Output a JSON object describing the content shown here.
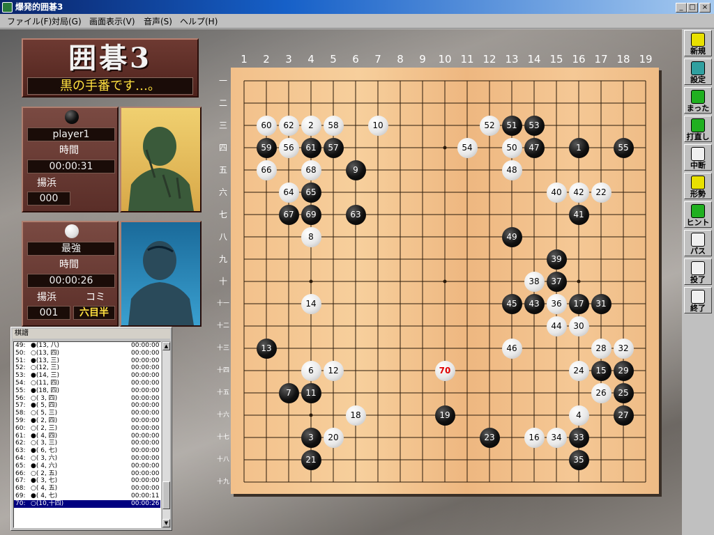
{
  "window": {
    "title": "爆発的囲碁3",
    "min": "_",
    "max": "□",
    "close": "×"
  },
  "menu": [
    "ファイル(F)",
    "対局(G)",
    "画面表示(V)",
    "音声(S)",
    "ヘルプ(H)"
  ],
  "logo": {
    "title": "囲碁3",
    "turn": "黒の手番です…。"
  },
  "player_black": {
    "name": "player1",
    "time_label": "時間",
    "time": "00:00:31",
    "captures_label": "揚浜",
    "captures": "000"
  },
  "player_white": {
    "name": "最強",
    "time_label": "時間",
    "time": "00:00:26",
    "captures_label": "揚浜",
    "komi_label": "コミ",
    "captures": "001",
    "komi": "六目半"
  },
  "kifu": {
    "title": "棋譜",
    "rows": [
      {
        "num": "49:",
        "move": "●(13, 八)",
        "time": "00:00:00"
      },
      {
        "num": "50:",
        "move": "○(13, 四)",
        "time": "00:00:00"
      },
      {
        "num": "51:",
        "move": "●(13, 三)",
        "time": "00:00:00"
      },
      {
        "num": "52:",
        "move": "○(12, 三)",
        "time": "00:00:00"
      },
      {
        "num": "53:",
        "move": "●(14, 三)",
        "time": "00:00:00"
      },
      {
        "num": "54:",
        "move": "○(11, 四)",
        "time": "00:00:00"
      },
      {
        "num": "55:",
        "move": "●(18, 四)",
        "time": "00:00:00"
      },
      {
        "num": "56:",
        "move": "○( 3, 四)",
        "time": "00:00:00"
      },
      {
        "num": "57:",
        "move": "●( 5, 四)",
        "time": "00:00:00"
      },
      {
        "num": "58:",
        "move": "○( 5, 三)",
        "time": "00:00:00"
      },
      {
        "num": "59:",
        "move": "●( 2, 四)",
        "time": "00:00:00"
      },
      {
        "num": "60:",
        "move": "○( 2, 三)",
        "time": "00:00:00"
      },
      {
        "num": "61:",
        "move": "●( 4, 四)",
        "time": "00:00:00"
      },
      {
        "num": "62:",
        "move": "○( 3, 三)",
        "time": "00:00:00"
      },
      {
        "num": "63:",
        "move": "●( 6, 七)",
        "time": "00:00:00"
      },
      {
        "num": "64:",
        "move": "○( 3, 六)",
        "time": "00:00:00"
      },
      {
        "num": "65:",
        "move": "●( 4, 六)",
        "time": "00:00:00"
      },
      {
        "num": "66:",
        "move": "○( 2, 五)",
        "time": "00:00:00"
      },
      {
        "num": "67:",
        "move": "●( 3, 七)",
        "time": "00:00:00"
      },
      {
        "num": "68:",
        "move": "○( 4, 五)",
        "time": "00:00:00"
      },
      {
        "num": "69:",
        "move": "●( 4, 七)",
        "time": "00:00:11"
      },
      {
        "num": "70:",
        "move": "○(10,十四)",
        "time": "00:00:26"
      }
    ]
  },
  "board": {
    "col_labels": [
      "1",
      "2",
      "3",
      "4",
      "5",
      "6",
      "7",
      "8",
      "9",
      "10",
      "11",
      "12",
      "13",
      "14",
      "15",
      "16",
      "17",
      "18",
      "19"
    ],
    "row_labels": [
      "一",
      "二",
      "三",
      "四",
      "五",
      "六",
      "七",
      "八",
      "九",
      "十",
      "十一",
      "十二",
      "十三",
      "十四",
      "十五",
      "十六",
      "十七",
      "十八",
      "十九"
    ],
    "last_move": 70,
    "stones": [
      {
        "c": "w",
        "col": 2,
        "row": 3,
        "n": "60"
      },
      {
        "c": "w",
        "col": 3,
        "row": 3,
        "n": "62"
      },
      {
        "c": "w",
        "col": 4,
        "row": 3,
        "n": "2"
      },
      {
        "c": "w",
        "col": 5,
        "row": 3,
        "n": "58"
      },
      {
        "c": "w",
        "col": 7,
        "row": 3,
        "n": "10"
      },
      {
        "c": "w",
        "col": 12,
        "row": 3,
        "n": "52"
      },
      {
        "c": "b",
        "col": 13,
        "row": 3,
        "n": "51"
      },
      {
        "c": "b",
        "col": 14,
        "row": 3,
        "n": "53"
      },
      {
        "c": "b",
        "col": 2,
        "row": 4,
        "n": "59"
      },
      {
        "c": "w",
        "col": 3,
        "row": 4,
        "n": "56"
      },
      {
        "c": "b",
        "col": 4,
        "row": 4,
        "n": "61"
      },
      {
        "c": "b",
        "col": 5,
        "row": 4,
        "n": "57"
      },
      {
        "c": "w",
        "col": 11,
        "row": 4,
        "n": "54"
      },
      {
        "c": "w",
        "col": 13,
        "row": 4,
        "n": "50"
      },
      {
        "c": "b",
        "col": 14,
        "row": 4,
        "n": "47"
      },
      {
        "c": "b",
        "col": 16,
        "row": 4,
        "n": "1"
      },
      {
        "c": "b",
        "col": 18,
        "row": 4,
        "n": "55"
      },
      {
        "c": "w",
        "col": 2,
        "row": 5,
        "n": "66"
      },
      {
        "c": "w",
        "col": 4,
        "row": 5,
        "n": "68"
      },
      {
        "c": "b",
        "col": 6,
        "row": 5,
        "n": "9"
      },
      {
        "c": "w",
        "col": 13,
        "row": 5,
        "n": "48"
      },
      {
        "c": "w",
        "col": 3,
        "row": 6,
        "n": "64"
      },
      {
        "c": "b",
        "col": 4,
        "row": 6,
        "n": "65"
      },
      {
        "c": "w",
        "col": 15,
        "row": 6,
        "n": "40"
      },
      {
        "c": "w",
        "col": 16,
        "row": 6,
        "n": "42"
      },
      {
        "c": "w",
        "col": 17,
        "row": 6,
        "n": "22"
      },
      {
        "c": "b",
        "col": 3,
        "row": 7,
        "n": "67"
      },
      {
        "c": "b",
        "col": 4,
        "row": 7,
        "n": "69"
      },
      {
        "c": "b",
        "col": 6,
        "row": 7,
        "n": "63"
      },
      {
        "c": "b",
        "col": 16,
        "row": 7,
        "n": "41"
      },
      {
        "c": "w",
        "col": 4,
        "row": 8,
        "n": "8"
      },
      {
        "c": "b",
        "col": 13,
        "row": 8,
        "n": "49"
      },
      {
        "c": "b",
        "col": 15,
        "row": 9,
        "n": "39"
      },
      {
        "c": "w",
        "col": 14,
        "row": 10,
        "n": "38"
      },
      {
        "c": "b",
        "col": 15,
        "row": 10,
        "n": "37"
      },
      {
        "c": "w",
        "col": 4,
        "row": 11,
        "n": "14"
      },
      {
        "c": "b",
        "col": 13,
        "row": 11,
        "n": "45"
      },
      {
        "c": "b",
        "col": 14,
        "row": 11,
        "n": "43"
      },
      {
        "c": "w",
        "col": 15,
        "row": 11,
        "n": "36"
      },
      {
        "c": "b",
        "col": 16,
        "row": 11,
        "n": "17"
      },
      {
        "c": "b",
        "col": 17,
        "row": 11,
        "n": "31"
      },
      {
        "c": "w",
        "col": 15,
        "row": 12,
        "n": "44"
      },
      {
        "c": "w",
        "col": 16,
        "row": 12,
        "n": "30"
      },
      {
        "c": "b",
        "col": 2,
        "row": 13,
        "n": "13"
      },
      {
        "c": "w",
        "col": 13,
        "row": 13,
        "n": "46"
      },
      {
        "c": "w",
        "col": 17,
        "row": 13,
        "n": "28"
      },
      {
        "c": "w",
        "col": 18,
        "row": 13,
        "n": "32"
      },
      {
        "c": "w",
        "col": 4,
        "row": 14,
        "n": "6"
      },
      {
        "c": "w",
        "col": 5,
        "row": 14,
        "n": "12"
      },
      {
        "c": "w",
        "col": 10,
        "row": 14,
        "n": "70"
      },
      {
        "c": "w",
        "col": 16,
        "row": 14,
        "n": "24"
      },
      {
        "c": "b",
        "col": 17,
        "row": 14,
        "n": "15"
      },
      {
        "c": "b",
        "col": 18,
        "row": 14,
        "n": "29"
      },
      {
        "c": "b",
        "col": 3,
        "row": 15,
        "n": "7"
      },
      {
        "c": "b",
        "col": 4,
        "row": 15,
        "n": "11"
      },
      {
        "c": "w",
        "col": 17,
        "row": 15,
        "n": "26"
      },
      {
        "c": "b",
        "col": 18,
        "row": 15,
        "n": "25"
      },
      {
        "c": "w",
        "col": 6,
        "row": 16,
        "n": "18"
      },
      {
        "c": "b",
        "col": 10,
        "row": 16,
        "n": "19"
      },
      {
        "c": "w",
        "col": 16,
        "row": 16,
        "n": "4"
      },
      {
        "c": "b",
        "col": 18,
        "row": 16,
        "n": "27"
      },
      {
        "c": "b",
        "col": 4,
        "row": 17,
        "n": "3"
      },
      {
        "c": "w",
        "col": 5,
        "row": 17,
        "n": "20"
      },
      {
        "c": "b",
        "col": 12,
        "row": 17,
        "n": "23"
      },
      {
        "c": "w",
        "col": 14,
        "row": 17,
        "n": "16"
      },
      {
        "c": "w",
        "col": 15,
        "row": 17,
        "n": "34"
      },
      {
        "c": "b",
        "col": 16,
        "row": 17,
        "n": "33"
      },
      {
        "c": "b",
        "col": 4,
        "row": 18,
        "n": "21"
      },
      {
        "c": "b",
        "col": 16,
        "row": 18,
        "n": "35"
      }
    ]
  },
  "toolbar": [
    {
      "id": "new",
      "label": "新規",
      "icon": "grid-icon",
      "color": "#e8e000"
    },
    {
      "id": "settings",
      "label": "設定",
      "icon": "settings-icon",
      "color": "#30a0a0"
    },
    {
      "id": "undo",
      "label": "まった",
      "icon": "undo-hand-icon",
      "color": "#20b020"
    },
    {
      "id": "redo",
      "label": "打直し",
      "icon": "redo-icon",
      "color": "#20b020"
    },
    {
      "id": "pause",
      "label": "中断",
      "icon": "trash-icon",
      "color": "#f0f0f0"
    },
    {
      "id": "position",
      "label": "形勢",
      "icon": "board-icon",
      "color": "#e8e000"
    },
    {
      "id": "hint",
      "label": "ヒント",
      "icon": "question-icon",
      "color": "#20b020"
    },
    {
      "id": "pass",
      "label": "パス",
      "icon": "speech-bubble-icon",
      "color": "#f0f0f0"
    },
    {
      "id": "resign",
      "label": "投了",
      "icon": "flag-icon",
      "color": "#f0f0f0"
    },
    {
      "id": "quit",
      "label": "終了",
      "icon": "hand-icon",
      "color": "#f0f0f0"
    }
  ]
}
